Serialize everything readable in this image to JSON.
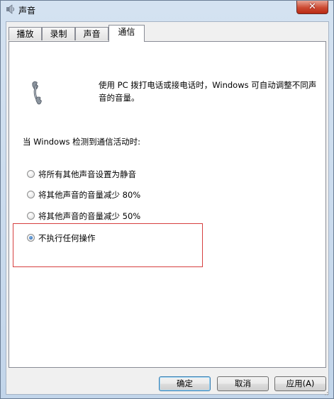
{
  "window": {
    "title": "声音",
    "close_glyph": "✕"
  },
  "tabs": [
    {
      "label": "播放"
    },
    {
      "label": "录制"
    },
    {
      "label": "声音"
    },
    {
      "label": "通信"
    }
  ],
  "panel": {
    "description": "使用 PC 拨打电话或接电话时，Windows 可自动调整不同声音的音量。",
    "section_label": "当 Windows 检测到通信活动时:",
    "options": [
      {
        "label": "将所有其他声音设置为静音",
        "checked": false
      },
      {
        "label": "将其他声音的音量减少 80%",
        "checked": false
      },
      {
        "label": "将其他声音的音量减少 50%",
        "checked": false
      },
      {
        "label": "不执行任何操作",
        "checked": true
      }
    ]
  },
  "buttons": {
    "ok": "确定",
    "cancel": "取消",
    "apply": "应用(A)"
  },
  "colors": {
    "highlight_border": "#d63f3f",
    "window_frame": "#c4d6ea"
  }
}
